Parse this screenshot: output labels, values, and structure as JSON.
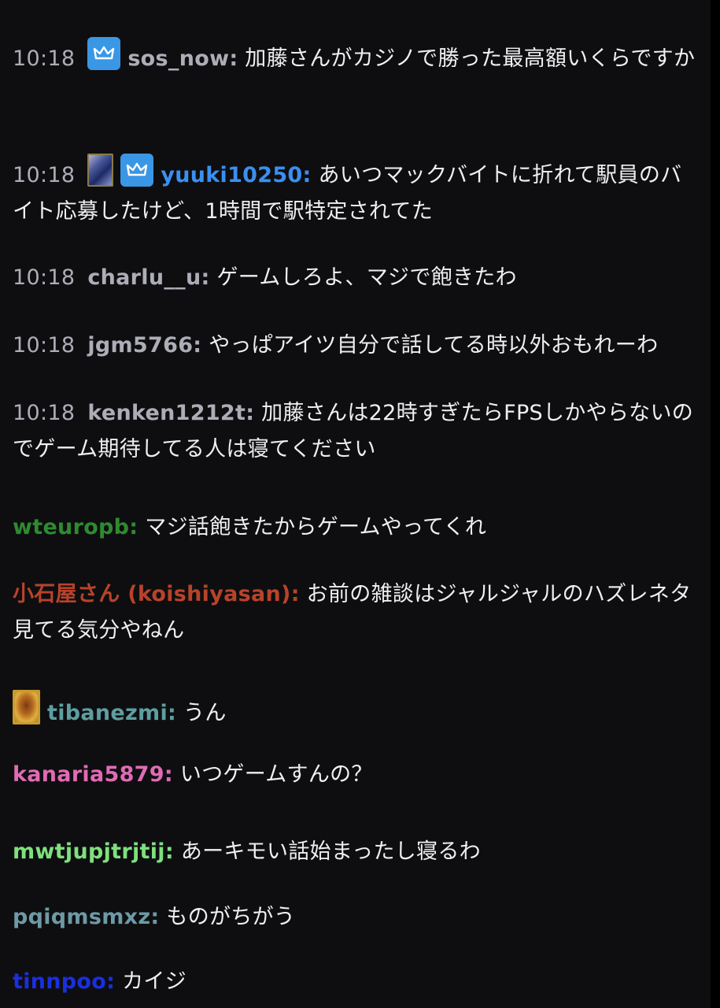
{
  "messages": [
    {
      "time": "10:18",
      "user": "sos_now:",
      "text": " 加藤さんがカジノで勝った最高額いくらですか",
      "color": "#adadb8",
      "badges": [
        "crown-icon"
      ]
    },
    {
      "time": "10:18",
      "user": "yuuki10250:",
      "text": " あいつマックバイトに折れて駅員のバイト応募したけど、1時間で駅特定されてた",
      "color": "#3b8ff0",
      "badges": [
        "subscriber-badge-icon",
        "crown-icon"
      ]
    },
    {
      "time": "10:18",
      "user": "charlu__u:",
      "text": " ゲームしろよ、マジで飽きたわ",
      "color": "#adadb8",
      "badges": []
    },
    {
      "time": "10:18",
      "user": "jgm5766:",
      "text": " やっぱアイツ自分で話してる時以外おもれーわ",
      "color": "#adadb8",
      "badges": []
    },
    {
      "time": "10:18",
      "user": "kenken1212t:",
      "text": " 加藤さんは22時すぎたらFPSしかやらないのでゲーム期待してる人は寝てください",
      "color": "#adadb8",
      "badges": []
    },
    {
      "time": "",
      "user": "wteuropb:",
      "text": " マジ話飽きたからゲームやってくれ",
      "color": "#2f8a2f",
      "badges": []
    },
    {
      "time": "",
      "user": "小石屋さん (koishiyasan):",
      "text": " お前の雑談はジャルジャルのハズレネタ見てる気分やねん",
      "color": "#b8432a",
      "badges": []
    },
    {
      "time": "",
      "user": "tibanezmi:",
      "text": " うん",
      "color": "#5f9ea0",
      "badges": [
        "gold-badge-icon"
      ]
    },
    {
      "time": "",
      "user": "kanaria5879:",
      "text": " いつゲームすんの？",
      "color": "#e06bb5",
      "badges": []
    },
    {
      "time": "",
      "user": "mwtjupjtrjtij:",
      "text": " あーキモい話始まったし寝るわ",
      "color": "#7ee07e",
      "badges": []
    },
    {
      "time": "",
      "user": "pqiqmsmxz:",
      "text": " ものがちがう",
      "color": "#6d9aa6",
      "badges": []
    },
    {
      "time": "",
      "user": "tinnpoo:",
      "text": " カイジ",
      "color": "#1a2fe0",
      "badges": []
    }
  ]
}
